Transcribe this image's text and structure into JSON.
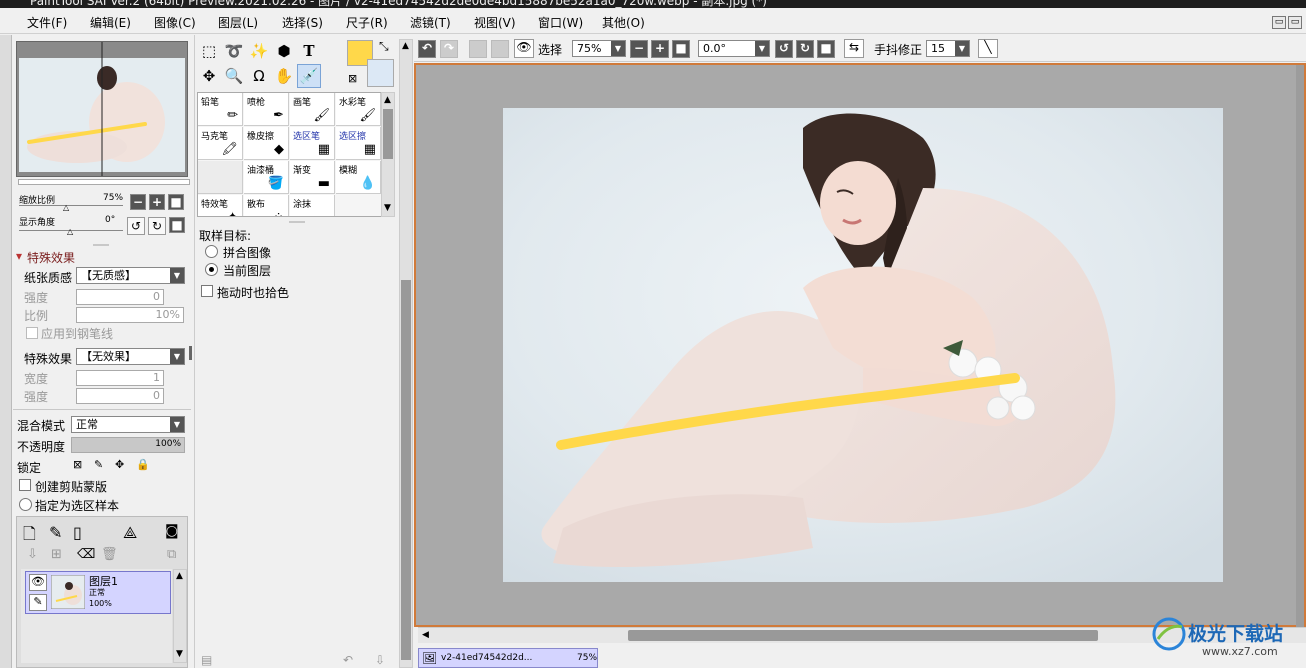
{
  "window": {
    "title": "PaintTool SAI Ver.2 (64bit) Preview.2021.02.26 - 图片 / v2-41ed74542d2de0de4bd15887be52a1a0_720w.webp - 副本.jpg (*)"
  },
  "menu": [
    "文件(F)",
    "编辑(E)",
    "图像(C)",
    "图层(L)",
    "选择(S)",
    "尺子(R)",
    "滤镜(T)",
    "视图(V)",
    "窗口(W)",
    "其他(O)"
  ],
  "navigator": {
    "zoom_label": "缩放比例",
    "zoom_value": "75%",
    "angle_label": "显示角度",
    "angle_value": "0°"
  },
  "effects": {
    "section_title": "特殊效果",
    "paper_label": "纸张质感",
    "paper_value": "【无质感】",
    "strength_label": "强度",
    "strength_value": "0",
    "ratio_label": "比例",
    "ratio_value": "10%",
    "apply_pen_label": "应用到钢笔线",
    "effect_label": "特殊效果",
    "effect_value": "【无效果】",
    "width_label": "宽度",
    "width_value": "1",
    "strength2_label": "强度",
    "strength2_value": "0"
  },
  "layer_props": {
    "blend_label": "混合模式",
    "blend_value": "正常",
    "opacity_label": "不透明度",
    "opacity_value": "100%",
    "opacity_fraction": 1.0,
    "lock_label": "锁定",
    "clip_label": "创建剪贴蒙版",
    "sample_label": "指定为选区样本"
  },
  "layers": [
    {
      "name": "图层1",
      "mode": "正常",
      "opacity": "100%"
    }
  ],
  "tools": {
    "color_primary": "#ffd84a",
    "color_secondary": "#dce8f5",
    "brushes": [
      {
        "name": "铅笔",
        "icon": "pencil-icon"
      },
      {
        "name": "喷枪",
        "icon": "airbrush-icon"
      },
      {
        "name": "画笔",
        "icon": "brush-icon"
      },
      {
        "name": "水彩笔",
        "icon": "watercolor-icon"
      },
      {
        "name": "马克笔",
        "icon": "marker-icon"
      },
      {
        "name": "橡皮擦",
        "icon": "eraser-icon"
      },
      {
        "name": "选区笔",
        "icon": "select-pen-icon"
      },
      {
        "name": "选区擦",
        "icon": "select-eraser-icon"
      },
      {
        "name": "",
        "icon": ""
      },
      {
        "name": "油漆桶",
        "icon": "bucket-icon"
      },
      {
        "name": "渐变",
        "icon": "gradient-icon"
      },
      {
        "name": "模糊",
        "icon": "blur-icon"
      },
      {
        "name": "特效笔",
        "icon": "effect-pen-icon"
      },
      {
        "name": "散布",
        "icon": "scatter-icon"
      },
      {
        "name": "涂抹",
        "icon": "smudge-icon"
      }
    ],
    "sample_target_label": "取样目标:",
    "opt_merged": "拼合图像",
    "opt_current": "当前图层",
    "drag_pick_label": "拖动时也拾色"
  },
  "toolbar": {
    "select_label": "选择",
    "zoom_value": "75%",
    "angle_value": "0.0°",
    "stabilizer_label": "手抖修正",
    "stabilizer_value": "15"
  },
  "doc_tab": {
    "name": "v2-41ed74542d2d...",
    "zoom": "75%"
  },
  "watermark": {
    "text": "极光下载站",
    "url": "www.xz7.com"
  }
}
